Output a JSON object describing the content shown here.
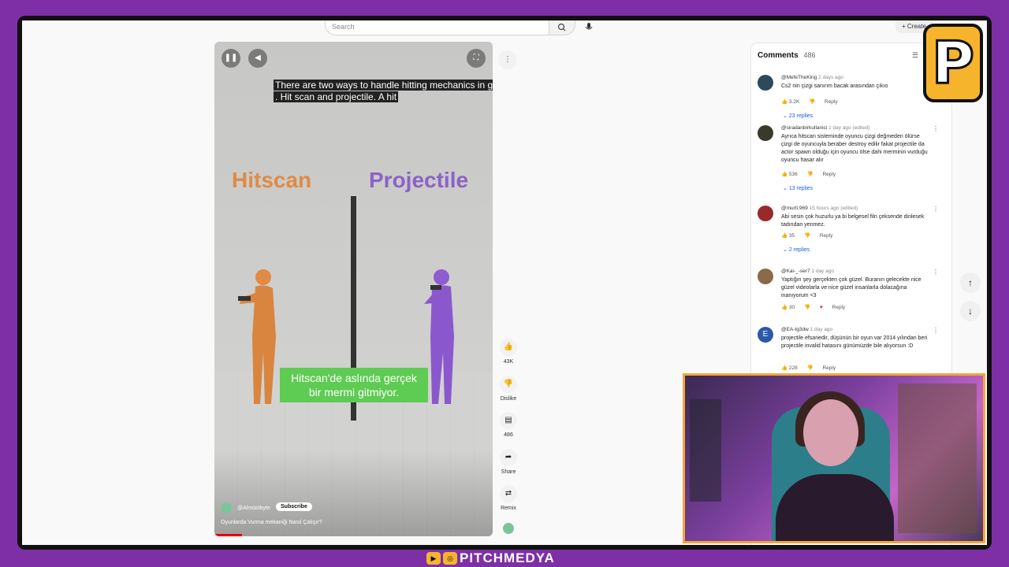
{
  "header": {
    "search_placeholder": "Search",
    "create_label": "+ Create"
  },
  "video": {
    "pause_icon": "pause-icon",
    "volume_icon": "volume-icon",
    "fullscreen_icon": "fullscreen-icon",
    "caption_top_line1": "There are two ways to handle hitting mechanics in ga",
    "caption_top_line2": ".  Hit scan and projectile.  A hit",
    "label_left": "Hitscan",
    "label_right": "Projectile",
    "caption_green_line1": "Hitscan'de aslında gerçek",
    "caption_green_line2": "bir mermi gitmiyor.",
    "channel_name": "@Almüstbyte",
    "subscribe_label": "Subscribe",
    "title": "Oyunlarda Vurma mekaniği Nasıl Çalışır?",
    "progress_fraction": 0.1
  },
  "actions": {
    "like_count": "43K",
    "dislike_label": "Dislike",
    "comment_count": "486",
    "share_label": "Share",
    "remix_label": "Remix"
  },
  "comments": {
    "title": "Comments",
    "count": "486",
    "items": [
      {
        "user": "@MefeTheKing",
        "ago": "2 days ago",
        "text": "Cs2 nin çizgi sanırım bacak arasından çıkıo",
        "likes": "3.2K",
        "reply_label": "Reply",
        "replies": "23 replies",
        "avatar_color": "#2c4a5a"
      },
      {
        "user": "@siradanbirkullanici",
        "ago": "1 day ago (edited)",
        "text": "Ayrıca hitscan sisteminde oyuncu çizgi değmeden ölürse çizgi de oyuncuyla beraber destroy edilir fakat projectile da actor spawn olduğu için oyuncu ölse dahi merminin vurduğu oyuncu hasar alır",
        "likes": "536",
        "reply_label": "Reply",
        "replies": "13 replies",
        "avatar_color": "#3a3a2a"
      },
      {
        "user": "@murti.969",
        "ago": "15 hours ago (edited)",
        "text": "Abi sesin çok huzurlu ya bi belgesel filn çeksende dinlesek tadından yenmez.",
        "likes": "35",
        "reply_label": "Reply",
        "replies": "2 replies",
        "avatar_color": "#9a2a2a"
      },
      {
        "user": "@Kai-_-ser7",
        "ago": "1 day ago",
        "text": "Yaptığın şey gerçekten çok güzel. Buranın gelecekte nice güzel videolarla ve nice güzel insanlarla dolacağına inanıyorum <3",
        "likes": "30",
        "reply_label": "Reply",
        "replies": "",
        "avatar_color": "#8a6a4a"
      },
      {
        "user": "@EA-tg3dw",
        "ago": "1 day ago",
        "text": "projectile efsanedir, düşünün bir oyun var 2014 yılından beri projectile invalid hatasını günümüzde bile alıyorsun :D",
        "likes": "228",
        "reply_label": "Reply",
        "replies": "",
        "avatar_letter": "E",
        "avatar_color": "#2a5aa8"
      }
    ]
  },
  "brand": {
    "text": "PITCHMEDYA",
    "logo_letter": "P"
  }
}
